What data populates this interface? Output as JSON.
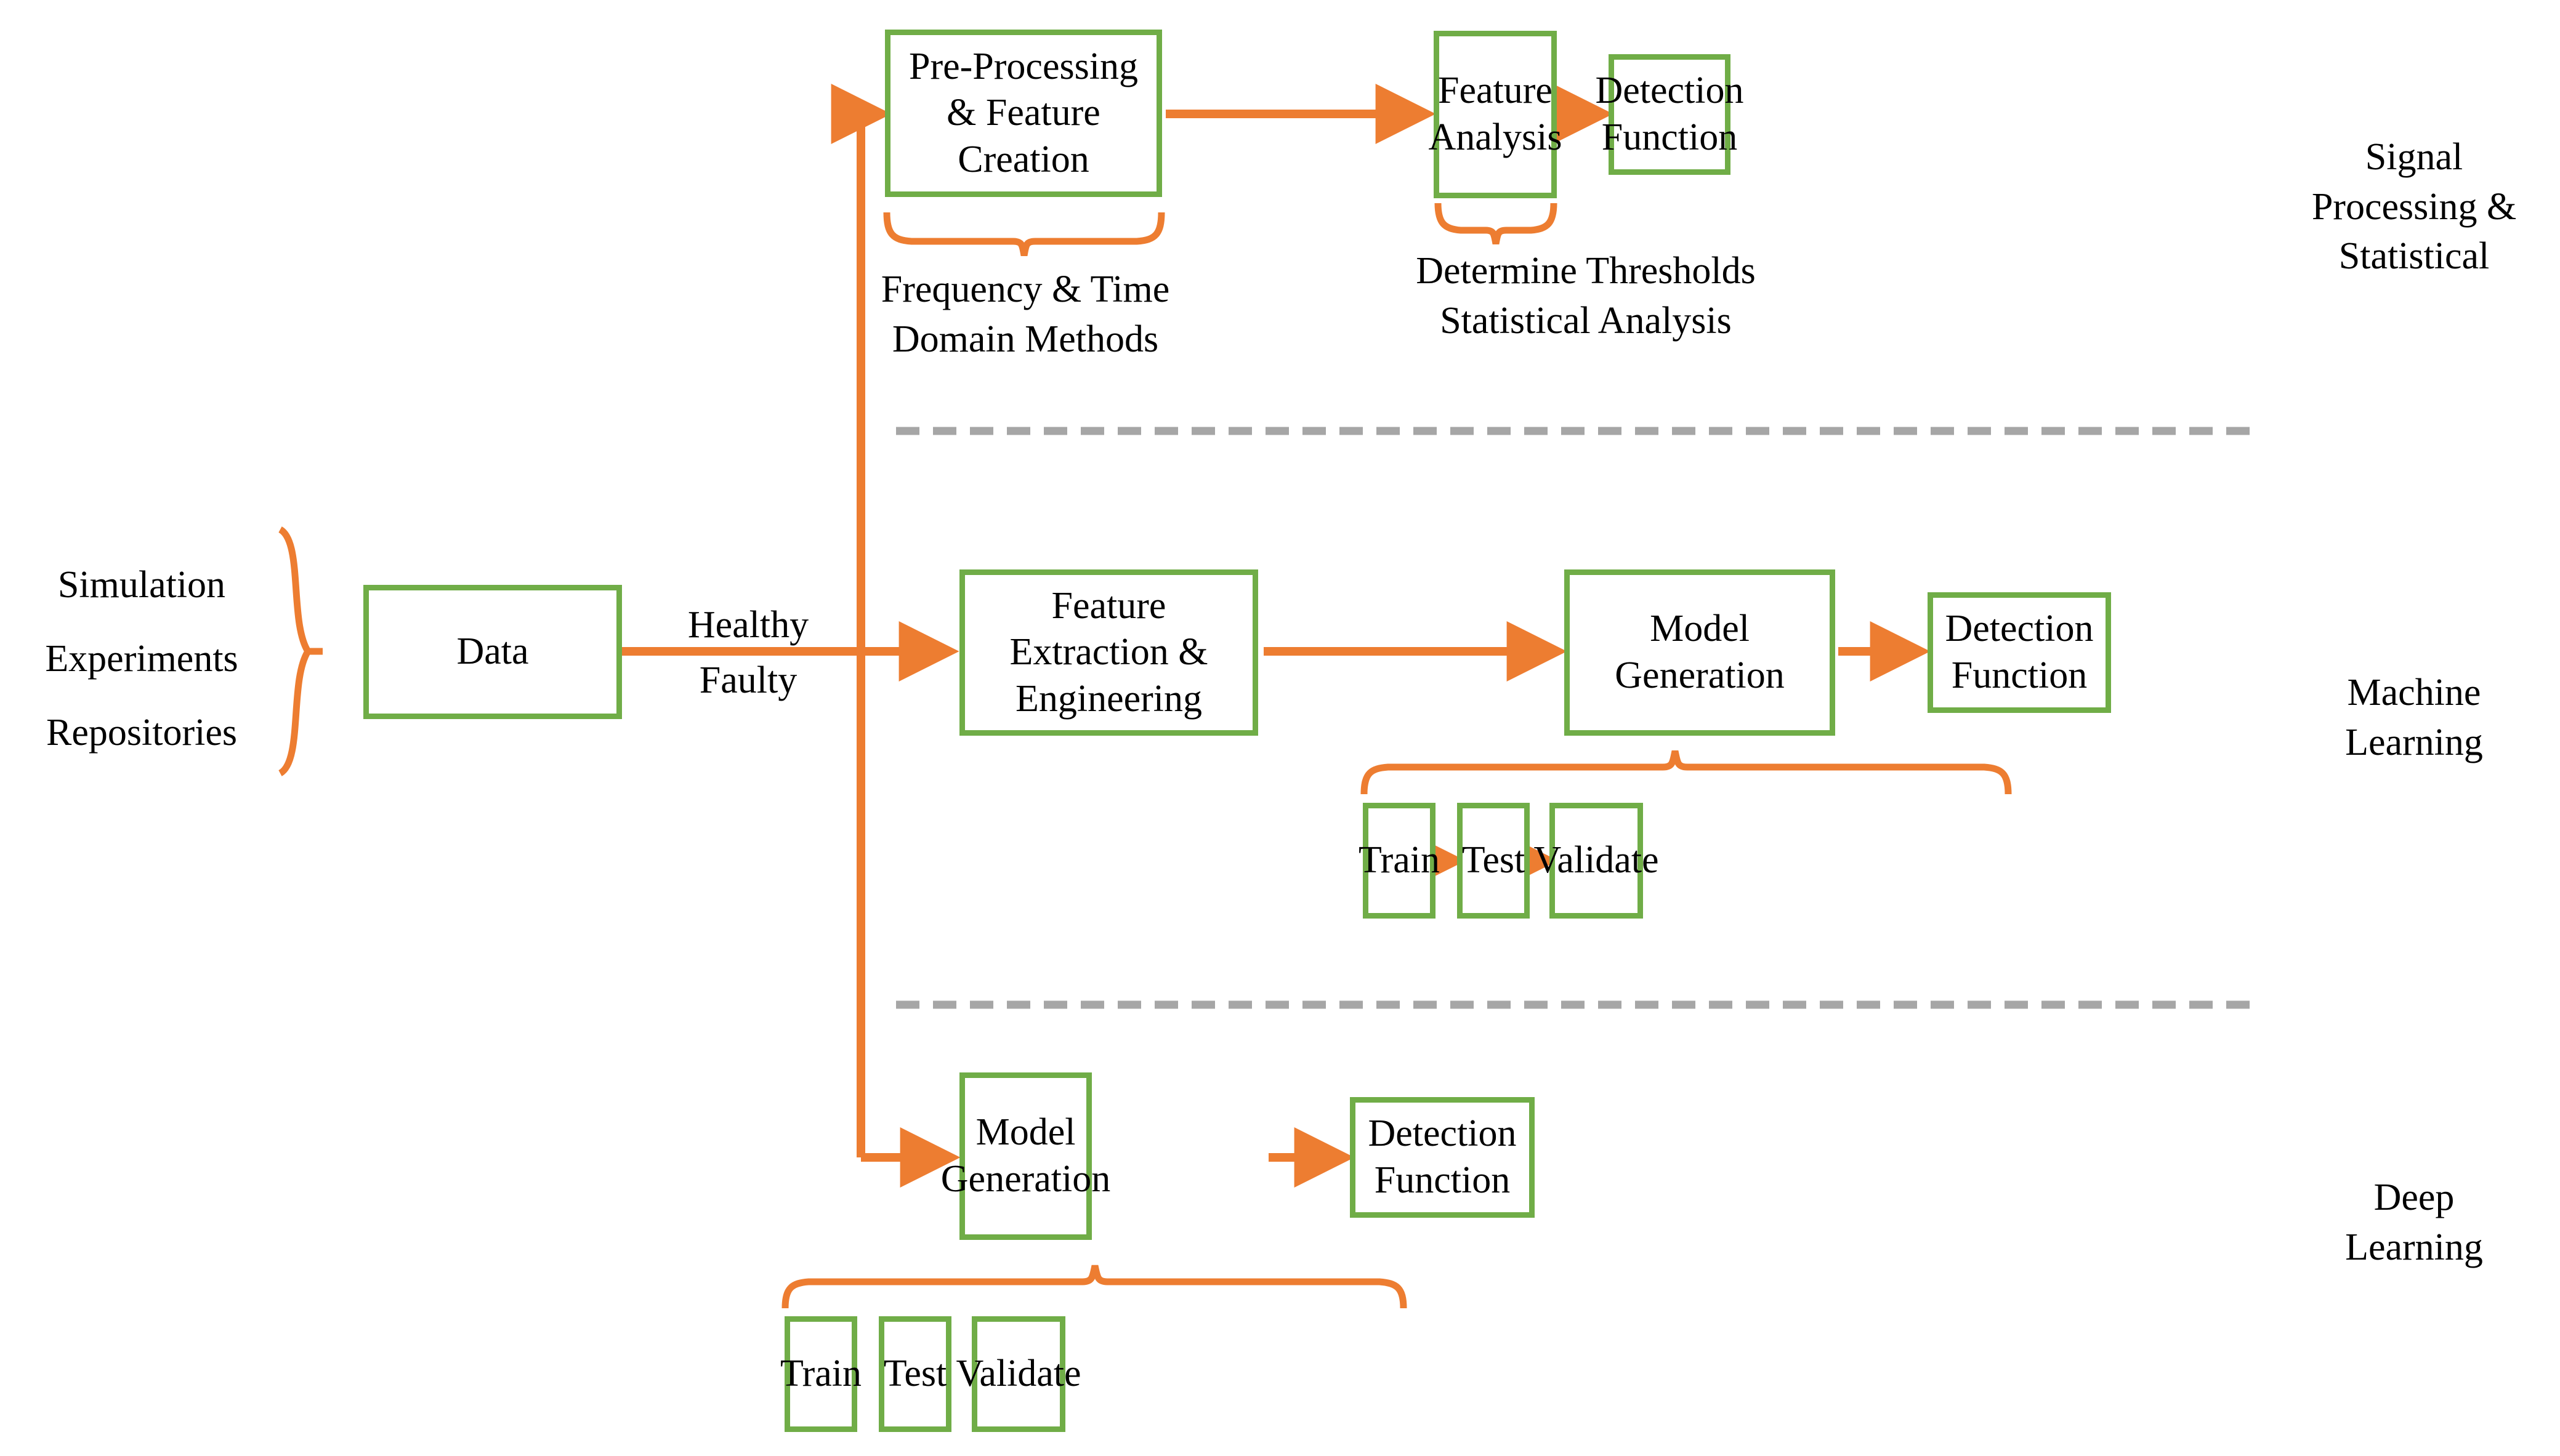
{
  "colors": {
    "box_border": "#70AD47",
    "arrow": "#ED7D31",
    "divider": "#A6A6A6",
    "text": "#000000",
    "background": "#FFFFFF"
  },
  "sources": {
    "items": [
      "Simulation",
      "Experiments",
      "Repositories"
    ],
    "brace": "left-curly-brace"
  },
  "data_node": {
    "label": "Data"
  },
  "split_label": {
    "line1": "Healthy",
    "line2": "Faulty"
  },
  "branches": [
    {
      "id": "signal-processing",
      "side_label": "Signal\nProcessing &\nStatistical",
      "nodes": [
        {
          "id": "pre-processing-feature-creation",
          "label": "Pre-Processing &\nFeature Creation"
        },
        {
          "id": "feature-analysis",
          "label": "Feature\nAnalysis"
        },
        {
          "id": "detection-function",
          "label": "Detection\nFunction"
        }
      ],
      "annotations": [
        {
          "id": "frequency-time-domain-methods",
          "label": "Frequency & Time\nDomain Methods"
        },
        {
          "id": "determine-thresholds-statistical-analysis",
          "label": "Determine Thresholds\nStatistical Analysis"
        }
      ]
    },
    {
      "id": "machine-learning",
      "side_label": "Machine\nLearning",
      "nodes": [
        {
          "id": "feature-extraction-engineering",
          "label": "Feature Extraction\n& Engineering"
        },
        {
          "id": "model-generation",
          "label": "Model\nGeneration"
        },
        {
          "id": "detection-function",
          "label": "Detection\nFunction"
        }
      ],
      "sub_nodes": [
        {
          "id": "train",
          "label": "Train"
        },
        {
          "id": "test",
          "label": "Test"
        },
        {
          "id": "validate",
          "label": "Validate"
        }
      ]
    },
    {
      "id": "deep-learning",
      "side_label": "Deep\nLearning",
      "nodes": [
        {
          "id": "model-generation",
          "label": "Model\nGeneration"
        },
        {
          "id": "detection-function",
          "label": "Detection\nFunction"
        }
      ],
      "sub_nodes": [
        {
          "id": "train",
          "label": "Train"
        },
        {
          "id": "test",
          "label": "Test"
        },
        {
          "id": "validate",
          "label": "Validate"
        }
      ]
    }
  ]
}
